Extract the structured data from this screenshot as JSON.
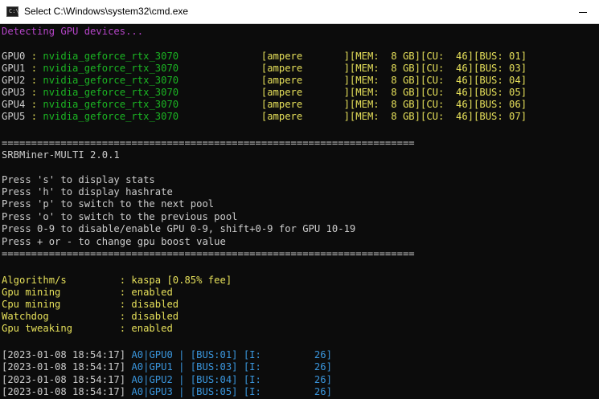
{
  "window": {
    "title": "Select C:\\Windows\\system32\\cmd.exe",
    "icon_text": "C:\\"
  },
  "console": {
    "detect_line": "Detecting GPU devices...",
    "gpus": [
      {
        "id": "GPU0",
        "sep": " : ",
        "name": "nvidia_geforce_rtx_3070",
        "pad": "              ",
        "info": "[ampere       ][MEM:  8 GB][CU:  46][BUS: 01]"
      },
      {
        "id": "GPU1",
        "sep": " : ",
        "name": "nvidia_geforce_rtx_3070",
        "pad": "              ",
        "info": "[ampere       ][MEM:  8 GB][CU:  46][BUS: 03]"
      },
      {
        "id": "GPU2",
        "sep": " : ",
        "name": "nvidia_geforce_rtx_3070",
        "pad": "              ",
        "info": "[ampere       ][MEM:  8 GB][CU:  46][BUS: 04]"
      },
      {
        "id": "GPU3",
        "sep": " : ",
        "name": "nvidia_geforce_rtx_3070",
        "pad": "              ",
        "info": "[ampere       ][MEM:  8 GB][CU:  46][BUS: 05]"
      },
      {
        "id": "GPU4",
        "sep": " : ",
        "name": "nvidia_geforce_rtx_3070",
        "pad": "              ",
        "info": "[ampere       ][MEM:  8 GB][CU:  46][BUS: 06]"
      },
      {
        "id": "GPU5",
        "sep": " : ",
        "name": "nvidia_geforce_rtx_3070",
        "pad": "              ",
        "info": "[ampere       ][MEM:  8 GB][CU:  46][BUS: 07]"
      }
    ],
    "separator": "======================================================================",
    "version": "SRBMiner-MULTI 2.0.1",
    "help": [
      "Press 's' to display stats",
      "Press 'h' to display hashrate",
      "Press 'p' to switch to the next pool",
      "Press 'o' to switch to the previous pool",
      "Press 0-9 to disable/enable GPU 0-9, shift+0-9 for GPU 10-19",
      "Press + or - to change gpu boost value"
    ],
    "settings": [
      {
        "label": "Algorithm/s         ",
        "value": ": kaspa [0.85% fee]"
      },
      {
        "label": "Gpu mining          ",
        "value": ": enabled"
      },
      {
        "label": "Cpu mining          ",
        "value": ": disabled"
      },
      {
        "label": "Watchdog            ",
        "value": ": disabled"
      },
      {
        "label": "Gpu tweaking        ",
        "value": ": enabled"
      }
    ],
    "log": [
      {
        "ts": "[2023-01-08 18:54:17] ",
        "body": "A0|GPU0 | [BUS:01] [I:         26]"
      },
      {
        "ts": "[2023-01-08 18:54:17] ",
        "body": "A0|GPU1 | [BUS:03] [I:         26]"
      },
      {
        "ts": "[2023-01-08 18:54:17] ",
        "body": "A0|GPU2 | [BUS:04] [I:         26]"
      },
      {
        "ts": "[2023-01-08 18:54:17] ",
        "body": "A0|GPU3 | [BUS:05] [I:         26]"
      }
    ]
  }
}
